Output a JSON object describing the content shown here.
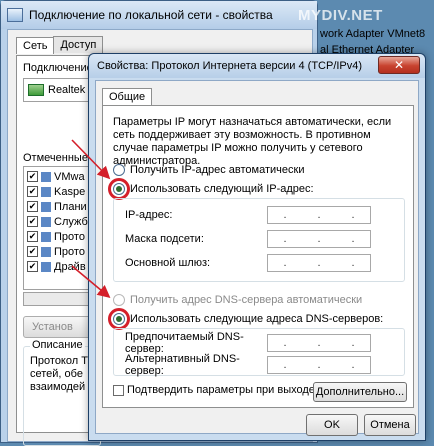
{
  "background_window": {
    "title": "Подключение по локальной сети - свойства",
    "tabs": [
      "Сеть",
      "Доступ"
    ],
    "connect_label": "Подключение",
    "adapter": "Realtek",
    "components_label": "Отмеченные к",
    "components": [
      "VMwa",
      "Kaspe",
      "Плани",
      "Служб",
      "Прото",
      "Прото",
      "Драйв"
    ],
    "install_button": "Установ",
    "description_title": "Описание",
    "description_text": [
      "Протокол Т",
      "сетей, обе",
      "взаимодей"
    ]
  },
  "behind_text": [
    "work Adapter VMnet8",
    "al Ethernet Adapter"
  ],
  "watermark": "MYDIV.NET",
  "dialog": {
    "title": "Свойства: Протокол Интернета версии 4 (TCP/IPv4)",
    "close_label": "✕",
    "tab": "Общие",
    "intro": "Параметры IP могут назначаться автоматически, если сеть поддерживает эту возможность. В противном случае параметры IP можно получить у сетевого администратора.",
    "ip_auto": "Получить IP-адрес автоматически",
    "ip_manual": "Использовать следующий IP-адрес:",
    "ip_address_label": "IP-адрес:",
    "subnet_label": "Маска подсети:",
    "gateway_label": "Основной шлюз:",
    "dns_auto": "Получить адрес DNS-сервера автоматически",
    "dns_manual": "Использовать следующие адреса DNS-серверов:",
    "dns_preferred_label": "Предпочитаемый DNS-сервер:",
    "dns_alternate_label": "Альтернативный DNS-сервер:",
    "confirm_on_exit": "Подтвердить параметры при выходе",
    "advanced_button": "Дополнительно...",
    "ok_button": "OK",
    "cancel_button": "Отмена",
    "ip_dot": "."
  },
  "colors": {
    "annotation_red": "#d41f2a",
    "radio_selected": "#2d6e2f"
  }
}
